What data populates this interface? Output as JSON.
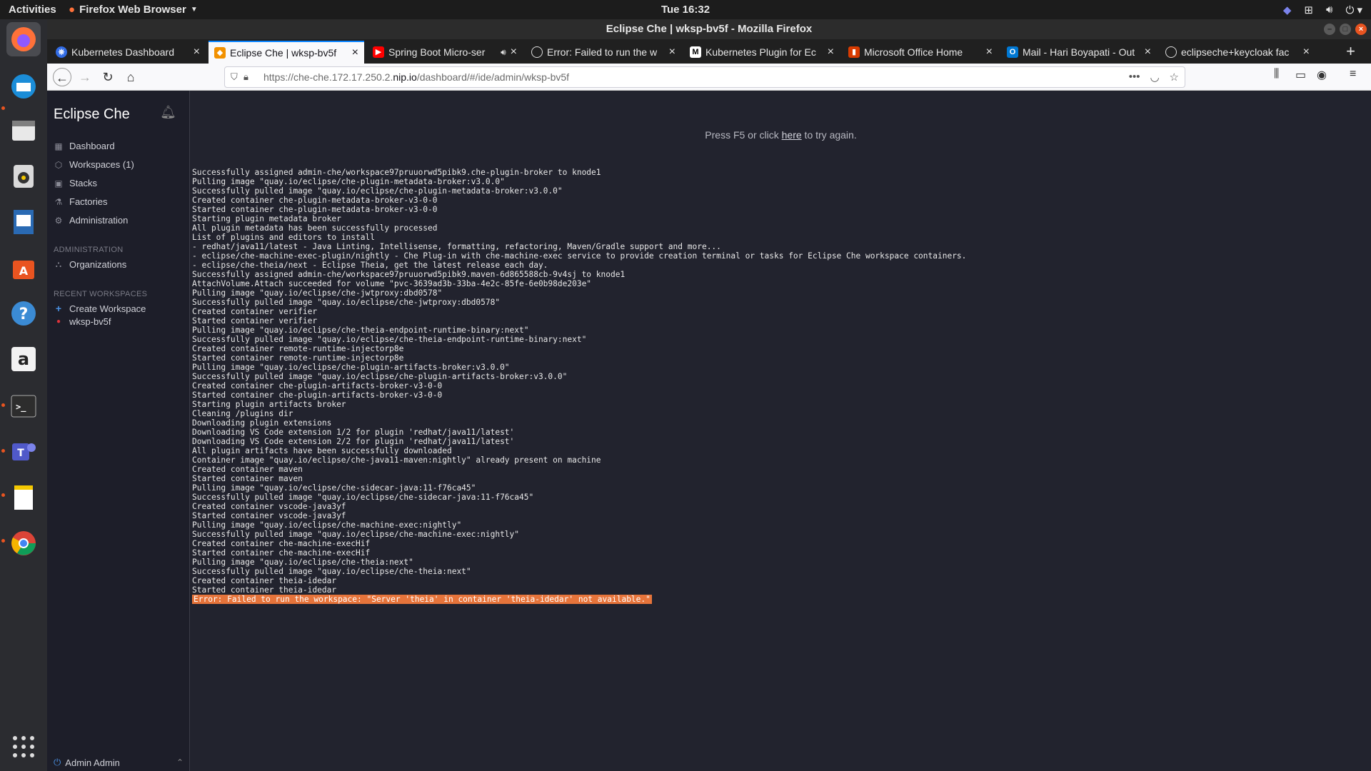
{
  "topbar": {
    "activities": "Activities",
    "app_name": "Firefox Web Browser",
    "clock": "Tue 16:32"
  },
  "dock": {
    "apps": [
      "firefox",
      "thunderbird",
      "files",
      "rhythmbox",
      "writer",
      "software-center",
      "help",
      "amazon",
      "terminal",
      "teams",
      "text-editor",
      "chrome"
    ],
    "show_apps": "show-applications"
  },
  "window": {
    "title": "Eclipse Che | wksp-bv5f - Mozilla Firefox"
  },
  "tabs": [
    {
      "label": "Kubernetes Dashboard",
      "icon": "kubernetes-icon",
      "color": "#326ce5"
    },
    {
      "label": "Eclipse Che | wksp-bv5f",
      "icon": "che-icon",
      "color": "#f29100",
      "active": true
    },
    {
      "label": "Spring Boot Micro-ser",
      "icon": "youtube-icon",
      "color": "#ff0000"
    },
    {
      "label": "Error: Failed to run the w",
      "icon": "github-icon",
      "color": "#ffffff"
    },
    {
      "label": "Kubernetes Plugin for Ec",
      "icon": "medium-icon",
      "color": "#000000"
    },
    {
      "label": "Microsoft Office Home",
      "icon": "office-icon",
      "color": "#d83b01"
    },
    {
      "label": "Mail - Hari Boyapati - Out",
      "icon": "outlook-icon",
      "color": "#0078d4"
    },
    {
      "label": "eclipseche+keycloak fac",
      "icon": "github-icon",
      "color": "#ffffff"
    }
  ],
  "navbar": {
    "url_prefix": "https://che-che.172.17.250.2.",
    "url_domain": "nip.io",
    "url_suffix": "/dashboard/#/ide/admin/wksp-bv5f"
  },
  "sidebar": {
    "brand": "Eclipse Che",
    "nav": [
      {
        "label": "Dashboard",
        "icon": "dashboard-icon"
      },
      {
        "label": "Workspaces (1)",
        "icon": "workspaces-icon"
      },
      {
        "label": "Stacks",
        "icon": "stacks-icon"
      },
      {
        "label": "Factories",
        "icon": "factories-icon"
      },
      {
        "label": "Administration",
        "icon": "gear-icon"
      }
    ],
    "admin_title": "ADMINISTRATION",
    "admin_items": [
      {
        "label": "Organizations",
        "icon": "organizations-icon"
      }
    ],
    "recent_title": "RECENT WORKSPACES",
    "recent_items": [
      {
        "label": "Create Workspace",
        "icon": "plus-icon"
      },
      {
        "label": "wksp-bv5f",
        "icon": "status-dot-icon",
        "status_color": "#e0333b"
      }
    ],
    "user": "Admin Admin"
  },
  "main": {
    "retry_pre": "Press F5 or click ",
    "retry_link": "here",
    "retry_post": " to try again.",
    "log_lines": [
      "Successfully assigned admin-che/workspace97pruuorwd5pibk9.che-plugin-broker to knode1",
      "Pulling image \"quay.io/eclipse/che-plugin-metadata-broker:v3.0.0\"",
      "Successfully pulled image \"quay.io/eclipse/che-plugin-metadata-broker:v3.0.0\"",
      "Created container che-plugin-metadata-broker-v3-0-0",
      "Started container che-plugin-metadata-broker-v3-0-0",
      "Starting plugin metadata broker",
      "All plugin metadata has been successfully processed",
      "List of plugins and editors to install",
      "- redhat/java11/latest - Java Linting, Intellisense, formatting, refactoring, Maven/Gradle support and more...",
      "- eclipse/che-machine-exec-plugin/nightly - Che Plug-in with che-machine-exec service to provide creation terminal or tasks for Eclipse Che workspace containers.",
      "- eclipse/che-theia/next - Eclipse Theia, get the latest release each day.",
      "Successfully assigned admin-che/workspace97pruuorwd5pibk9.maven-6d865588cb-9v4sj to knode1",
      "AttachVolume.Attach succeeded for volume \"pvc-3639ad3b-33ba-4e2c-85fe-6e0b98de203e\"",
      "Pulling image \"quay.io/eclipse/che-jwtproxy:dbd0578\"",
      "Successfully pulled image \"quay.io/eclipse/che-jwtproxy:dbd0578\"",
      "Created container verifier",
      "Started container verifier",
      "Pulling image \"quay.io/eclipse/che-theia-endpoint-runtime-binary:next\"",
      "Successfully pulled image \"quay.io/eclipse/che-theia-endpoint-runtime-binary:next\"",
      "Created container remote-runtime-injectorp8e",
      "Started container remote-runtime-injectorp8e",
      "Pulling image \"quay.io/eclipse/che-plugin-artifacts-broker:v3.0.0\"",
      "Successfully pulled image \"quay.io/eclipse/che-plugin-artifacts-broker:v3.0.0\"",
      "Created container che-plugin-artifacts-broker-v3-0-0",
      "Started container che-plugin-artifacts-broker-v3-0-0",
      "Starting plugin artifacts broker",
      "Cleaning /plugins dir",
      "Downloading plugin extensions",
      "Downloading VS Code extension 1/2 for plugin 'redhat/java11/latest'",
      "Downloading VS Code extension 2/2 for plugin 'redhat/java11/latest'",
      "All plugin artifacts have been successfully downloaded",
      "Container image \"quay.io/eclipse/che-java11-maven:nightly\" already present on machine",
      "Created container maven",
      "Started container maven",
      "Pulling image \"quay.io/eclipse/che-sidecar-java:11-f76ca45\"",
      "Successfully pulled image \"quay.io/eclipse/che-sidecar-java:11-f76ca45\"",
      "Created container vscode-java3yf",
      "Started container vscode-java3yf",
      "Pulling image \"quay.io/eclipse/che-machine-exec:nightly\"",
      "Successfully pulled image \"quay.io/eclipse/che-machine-exec:nightly\"",
      "Created container che-machine-execHif",
      "Started container che-machine-execHif",
      "Pulling image \"quay.io/eclipse/che-theia:next\"",
      "Successfully pulled image \"quay.io/eclipse/che-theia:next\"",
      "Created container theia-idedar",
      "Started container theia-idedar"
    ],
    "error_line": "Error: Failed to run the workspace: \"Server 'theia' in container 'theia-idedar' not available.\""
  },
  "colors": {
    "error_highlight": "#e6743b",
    "sidebar_bg": "#1d1e29",
    "content_bg": "#22232e",
    "accent_tab": "#0a84ff"
  }
}
